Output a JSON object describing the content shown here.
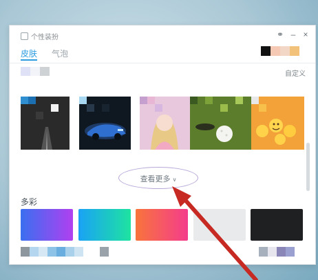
{
  "window": {
    "title": "个性装扮"
  },
  "tabs": [
    {
      "label": "皮肤",
      "active": true
    },
    {
      "label": "气泡",
      "active": false
    }
  ],
  "top_swatches": [
    "#111111",
    "#f6c9b5",
    "#f3d7c6",
    "#f2c27a"
  ],
  "custom_link": "自定义",
  "skin_thumbs": [
    {
      "name": "dark-road-skin",
      "base": "#2b2b2b",
      "accent": "#2f8fd1"
    },
    {
      "name": "blue-car-skin",
      "base": "#0f1820",
      "accent": "#3d8fe0"
    },
    {
      "name": "anime-girl-skin",
      "base": "#e5c1d9",
      "accent": "#ceaad0"
    },
    {
      "name": "golf-ball-skin",
      "base": "#5f7f2f",
      "accent": "#9fbb4a"
    },
    {
      "name": "emoji-skin",
      "base": "#f2a33a",
      "accent": "#f7c74f"
    }
  ],
  "more_button": {
    "label": "查看更多",
    "chevron": "chevron-down-icon"
  },
  "section": {
    "title": "多彩"
  },
  "color_cards": [
    {
      "name": "purple-blue-gradient",
      "from": "#3a6ff0",
      "to": "#b040f0"
    },
    {
      "name": "cyan-green-gradient",
      "from": "#1aa2f5",
      "to": "#1ee3a0"
    },
    {
      "name": "orange-pink-gradient",
      "from": "#f8743c",
      "to": "#f43c8c"
    },
    {
      "name": "light-gray-solid",
      "from": "#e9eaec",
      "to": "#e9eaec"
    },
    {
      "name": "black-solid",
      "from": "#1f2021",
      "to": "#1f2021"
    }
  ],
  "colors": {
    "accent": "#2e9de0",
    "arrow": "#c62a22",
    "highlight_ring": "#b7a7d8"
  }
}
